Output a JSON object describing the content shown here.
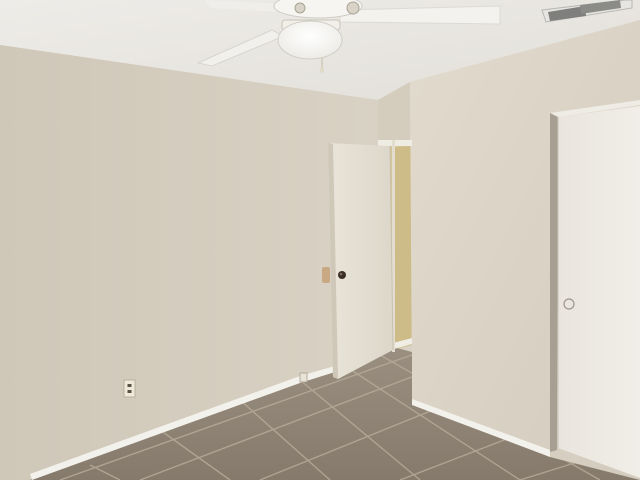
{
  "scene": {
    "description_tag": "empty-bedroom-interior",
    "colors": {
      "ceiling": "#e9e7e2",
      "wall_left": "#d6cfc1",
      "wall_right": "#ddd6c8",
      "wall_back": "#d8d0c0",
      "hallway_wall": "#d9c99c",
      "door": "#e6e1d6",
      "closet_door": "#ebe7e0",
      "baseboard": "#f4f2ee",
      "floor_tile": "#8f8476",
      "grout": "#b9ad9c",
      "fan_light": "#fbfaf6",
      "vent": "#9a9a98"
    },
    "objects": [
      "ceiling-fan",
      "light-fixture",
      "ceiling-vent",
      "open-door",
      "door-knob",
      "closet-door",
      "electrical-outlet",
      "tile-floor",
      "baseboard"
    ]
  }
}
